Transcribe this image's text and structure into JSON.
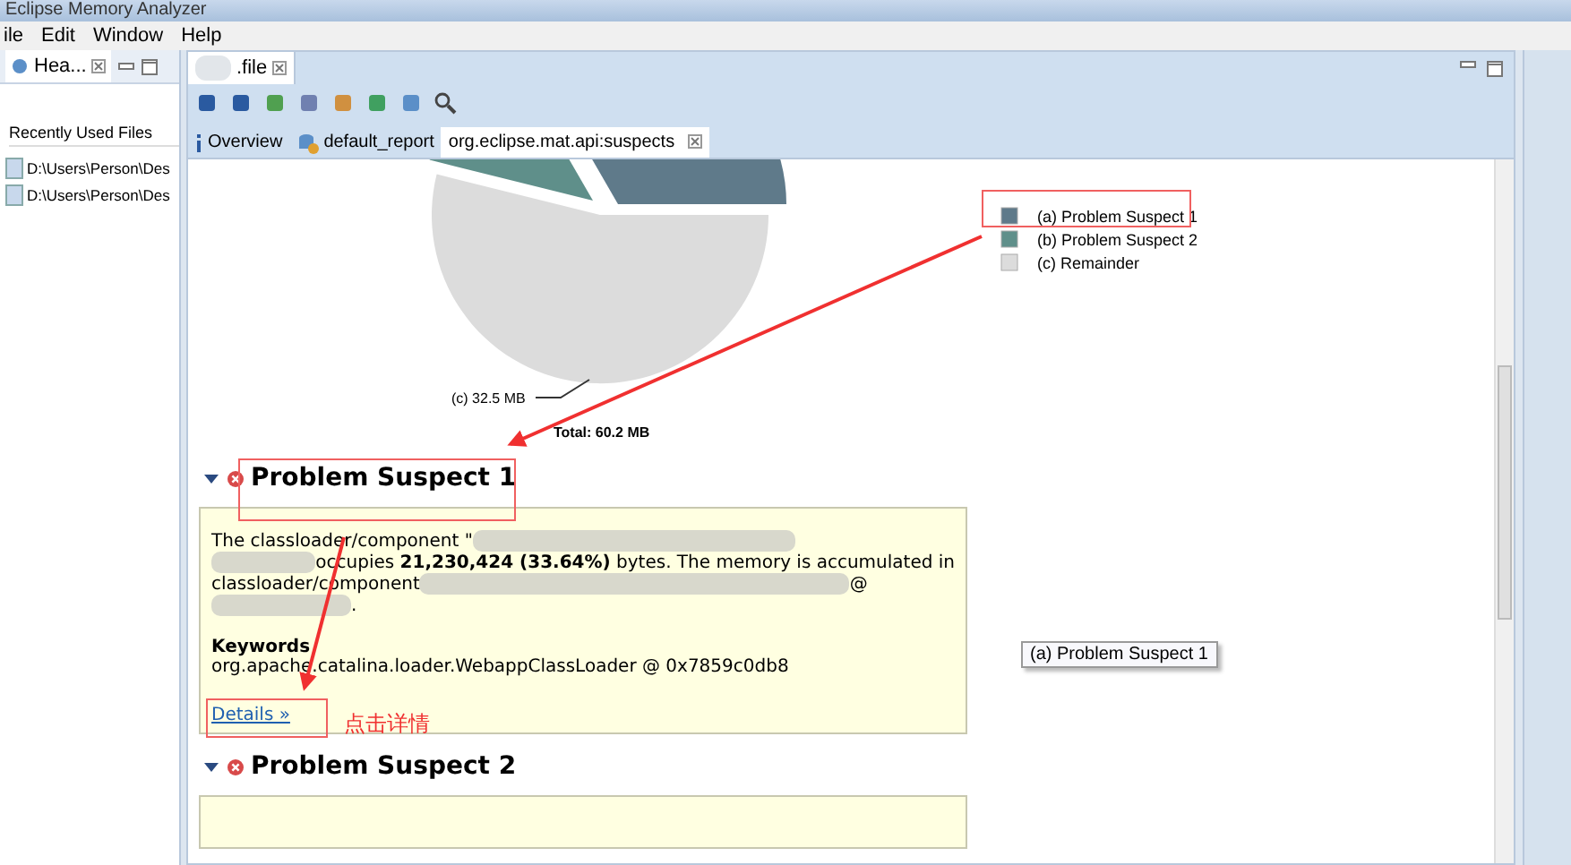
{
  "window": {
    "title": "Eclipse Memory Analyzer"
  },
  "menu": [
    "ile",
    "Edit",
    "Window",
    "Help"
  ],
  "left_panel": {
    "tab": "Hea...",
    "heading": "Recently Used Files",
    "items": [
      "D:\\Users\\Person\\Des",
      "D:\\Users\\Person\\Des"
    ]
  },
  "editor": {
    "tab": ".file",
    "subtabs": [
      {
        "label": "Overview",
        "selected": false
      },
      {
        "label": "default_report",
        "selected": false
      },
      {
        "label": "org.eclipse.mat.api:suspects",
        "selected": true
      }
    ],
    "chart": {
      "slice_label": "(c)  32.5 MB",
      "total": "Total: 60.2 MB",
      "legend": [
        {
          "label": "(a)  Problem Suspect 1",
          "color": "#5f7a8a"
        },
        {
          "label": "(b)  Problem Suspect 2",
          "color": "#5f8f8a"
        },
        {
          "label": "(c)  Remainder",
          "color": "#dcdcdc"
        }
      ]
    },
    "sections": [
      {
        "title": "Problem Suspect 1",
        "expanded": true,
        "lines": [
          "The classloader/component \"",
          "occupies **21,230,424 (33.64%)** bytes. The memory is accumulated in",
          "classloader/component",
          "@",
          "."
        ],
        "keywords_heading": "Keywords",
        "keywords": "org.apache.catalina.loader.WebappClassLoader @ 0x7859c0db8",
        "link": "Details »"
      },
      {
        "title": "Problem Suspect 2",
        "expanded": true
      }
    ],
    "tooltip": "(a)  Problem Suspect 1"
  },
  "annotation": {
    "text": "点击详情"
  }
}
